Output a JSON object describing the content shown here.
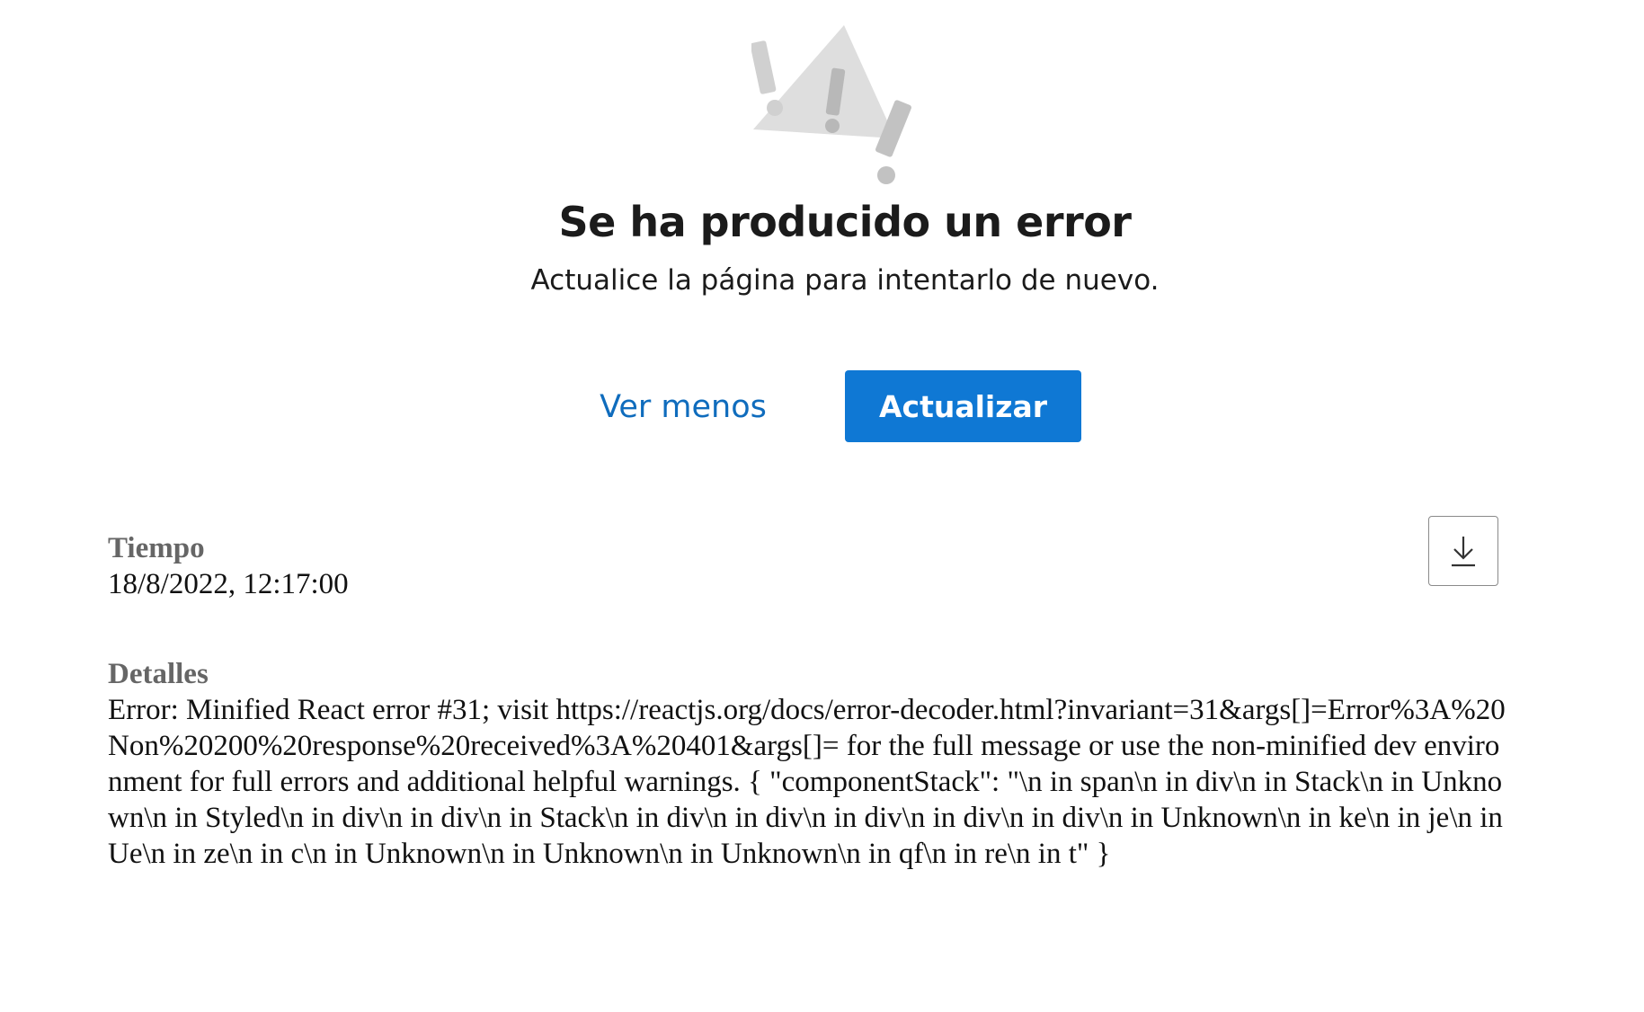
{
  "error": {
    "title": "Se ha producido un error",
    "subtitle": "Actualice la página para intentarlo de nuevo."
  },
  "actions": {
    "see_less_label": "Ver menos",
    "refresh_label": "Actualizar",
    "download_icon": "download-icon"
  },
  "details": {
    "time_label": "Tiempo",
    "time_value": "18/8/2022, 12:17:00",
    "details_label": "Detalles",
    "details_value": "Error: Minified React error #31; visit https://reactjs.org/docs/error-decoder.html?invariant=31&args[]=Error%3A%20Non%20200%20response%20received%3A%20401&args[]= for the full message or use the non-minified dev environment for full errors and additional helpful warnings. { \"componentStack\": \"\\n in span\\n in div\\n in Stack\\n in Unknown\\n in Styled\\n in div\\n in div\\n in Stack\\n in div\\n in div\\n in div\\n in div\\n in div\\n in Unknown\\n in ke\\n in je\\n in Ue\\n in ze\\n in c\\n in Unknown\\n in Unknown\\n in Unknown\\n in qf\\n in re\\n in t\" }"
  },
  "colors": {
    "primary": "#0f78d4",
    "link": "#0f6cbd",
    "illustration": "#dcdcdc"
  }
}
